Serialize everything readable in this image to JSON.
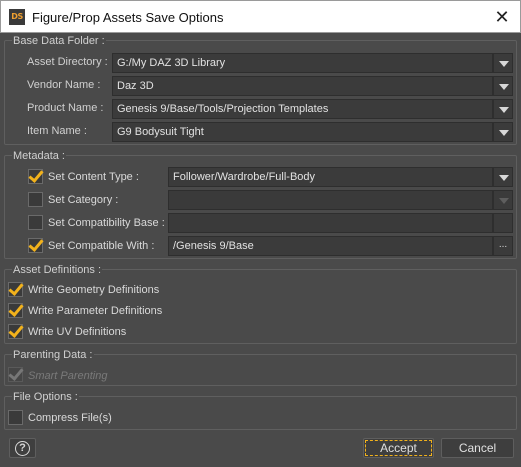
{
  "window": {
    "logo_text": "DS",
    "title": "Figure/Prop Assets Save Options",
    "close_glyph": "✕"
  },
  "base_data_folder": {
    "title": "Base Data Folder :",
    "asset_directory": {
      "label": "Asset Directory :",
      "value": "G:/My DAZ 3D Library"
    },
    "vendor_name": {
      "label": "Vendor Name :",
      "value": "Daz 3D"
    },
    "product_name": {
      "label": "Product Name :",
      "value": "Genesis 9/Base/Tools/Projection Templates"
    },
    "item_name": {
      "label": "Item Name :",
      "value": "G9 Bodysuit Tight"
    }
  },
  "metadata": {
    "title": "Metadata :",
    "content_type": {
      "label": "Set Content Type :",
      "checked": true,
      "value": "Follower/Wardrobe/Full-Body"
    },
    "category": {
      "label": "Set Category :",
      "checked": false,
      "value": ""
    },
    "compatibility_base": {
      "label": "Set Compatibility Base :",
      "checked": false,
      "value": ""
    },
    "compatible_with": {
      "label": "Set Compatible With :",
      "checked": true,
      "value": "/Genesis 9/Base",
      "browse": "..."
    }
  },
  "asset_definitions": {
    "title": "Asset Definitions :",
    "geometry": {
      "label": "Write Geometry Definitions",
      "checked": true
    },
    "parameter": {
      "label": "Write Parameter Definitions",
      "checked": true
    },
    "uv": {
      "label": "Write UV Definitions",
      "checked": true
    }
  },
  "parenting_data": {
    "title": "Parenting Data :",
    "smart_parenting": {
      "label": "Smart Parenting",
      "checked": true,
      "enabled": false
    }
  },
  "file_options": {
    "title": "File Options :",
    "compress": {
      "label": "Compress File(s)",
      "checked": false
    }
  },
  "footer": {
    "help_glyph": "?",
    "accept_label": "Accept",
    "cancel_label": "Cancel"
  },
  "colors": {
    "dialog_bg": "#4a4a4a",
    "field_bg": "#3b3b3b",
    "check_accent": "#f2b21c"
  }
}
